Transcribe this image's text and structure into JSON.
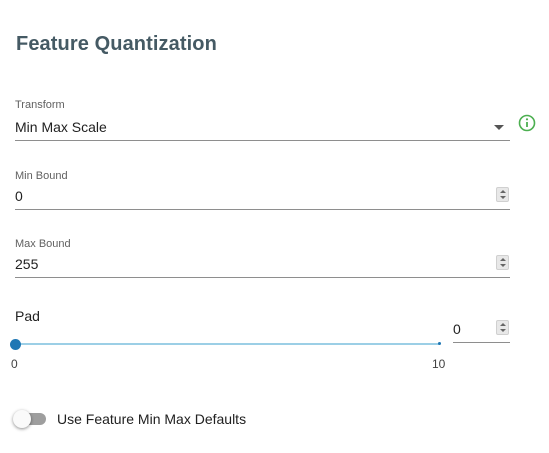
{
  "page": {
    "title": "Feature Quantization"
  },
  "transform": {
    "label": "Transform",
    "value": "Min Max Scale",
    "info_icon": "info-circle-icon"
  },
  "min_bound": {
    "label": "Min Bound",
    "value": "0"
  },
  "max_bound": {
    "label": "Max Bound",
    "value": "255"
  },
  "pad": {
    "label": "Pad",
    "value": "0",
    "slider_min": "0",
    "slider_max": "10",
    "slider_fraction": 0
  },
  "defaults_toggle": {
    "label": "Use Feature Min Max Defaults",
    "checked": false
  },
  "colors": {
    "title": "#455a64",
    "accent": "#1f77b4",
    "info": "#4caf50"
  }
}
